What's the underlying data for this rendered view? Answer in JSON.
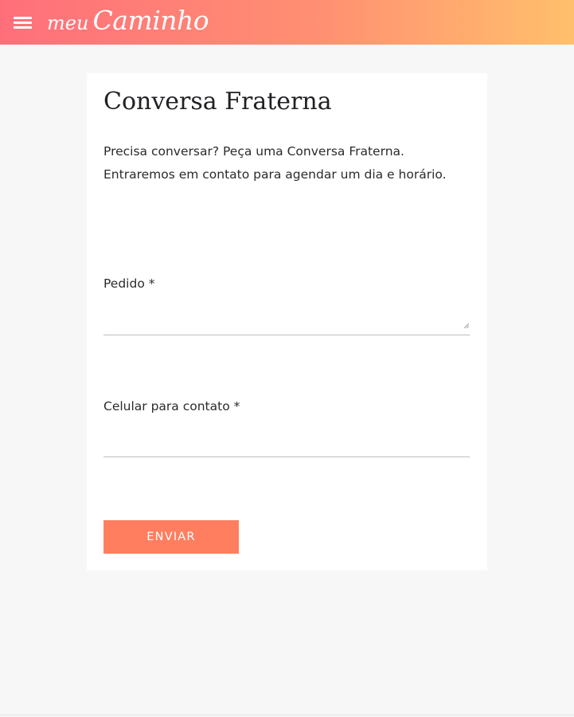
{
  "header": {
    "brand_prefix": "meu",
    "brand_name": "Caminho",
    "menu_icon": "hamburger-menu-icon",
    "gradient_colors": [
      "#ff6f7b",
      "#ff8f72",
      "#ffc06c"
    ]
  },
  "form": {
    "title": "Conversa Fraterna",
    "intro": "Precisa conversar? Peça uma Conversa Fraterna. Entraremos em contato para agendar um dia e horário.",
    "request_label": "Pedido *",
    "request_value": "",
    "phone_label": "Celular para contato *",
    "phone_value": "",
    "submit_label": "ENVIAR",
    "submit_color": "#ff7e5f"
  }
}
